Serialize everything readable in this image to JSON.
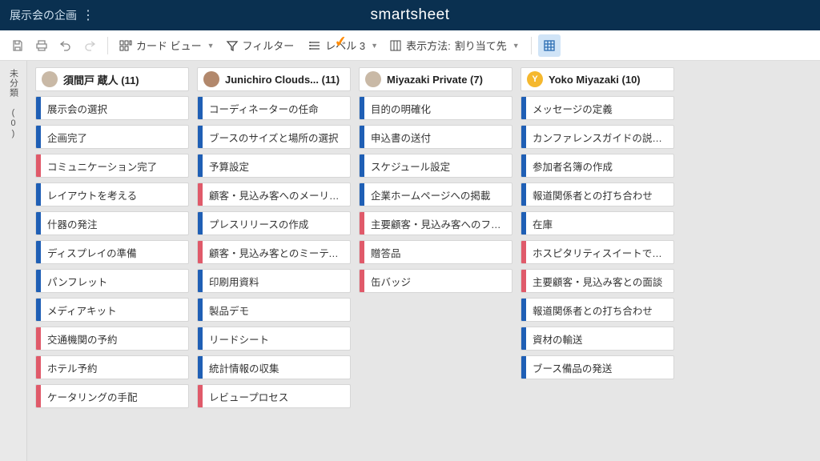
{
  "header": {
    "title": "展示会の企画",
    "brand": "smartsheet"
  },
  "toolbar": {
    "card_view": "カード ビュー",
    "filter": "フィルター",
    "level": "レベル 3",
    "display_method_label": "表示方法:",
    "display_method_value": "割り当て先"
  },
  "side": {
    "label": "未分類 (0)"
  },
  "colors": {
    "blue": "#1f5fb5",
    "red": "#e05a6a"
  },
  "columns": [
    {
      "title": "須間戸 蔵人 (11)",
      "avatar_color": "#c9b9a6",
      "avatar_text": "",
      "cards": [
        {
          "color": "blue",
          "text": "展示会の選択"
        },
        {
          "color": "blue",
          "text": "企画完了"
        },
        {
          "color": "red",
          "text": "コミュニケーション完了"
        },
        {
          "color": "blue",
          "text": "レイアウトを考える"
        },
        {
          "color": "blue",
          "text": "什器の発注"
        },
        {
          "color": "blue",
          "text": "ディスプレイの準備"
        },
        {
          "color": "blue",
          "text": "パンフレット"
        },
        {
          "color": "blue",
          "text": "メディアキット"
        },
        {
          "color": "red",
          "text": "交通機関の予約"
        },
        {
          "color": "red",
          "text": "ホテル予約"
        },
        {
          "color": "red",
          "text": "ケータリングの手配"
        }
      ]
    },
    {
      "title": "Junichiro Clouds... (11)",
      "avatar_color": "#b2886c",
      "avatar_text": "",
      "cards": [
        {
          "color": "blue",
          "text": "コーディネーターの任命"
        },
        {
          "color": "blue",
          "text": "ブースのサイズと場所の選択"
        },
        {
          "color": "blue",
          "text": "予算設定"
        },
        {
          "color": "red",
          "text": "顧客・見込み客へのメーリン..."
        },
        {
          "color": "blue",
          "text": "プレスリリースの作成"
        },
        {
          "color": "red",
          "text": "顧客・見込み客とのミーティ..."
        },
        {
          "color": "blue",
          "text": "印刷用資料"
        },
        {
          "color": "blue",
          "text": "製品デモ"
        },
        {
          "color": "blue",
          "text": "リードシート"
        },
        {
          "color": "blue",
          "text": "統計情報の収集"
        },
        {
          "color": "red",
          "text": "レビュープロセス"
        }
      ]
    },
    {
      "title": "Miyazaki Private (7)",
      "avatar_color": "#c9b9a6",
      "avatar_text": "",
      "cards": [
        {
          "color": "blue",
          "text": "目的の明確化"
        },
        {
          "color": "blue",
          "text": "申込書の送付"
        },
        {
          "color": "blue",
          "text": "スケジュール設定"
        },
        {
          "color": "blue",
          "text": "企業ホームページへの掲載"
        },
        {
          "color": "red",
          "text": "主要顧客・見込み客へのフリ..."
        },
        {
          "color": "red",
          "text": "贈答品"
        },
        {
          "color": "red",
          "text": "缶バッジ"
        }
      ]
    },
    {
      "title": "Yoko Miyazaki (10)",
      "avatar_color": "#f5b82e",
      "avatar_text": "Y",
      "cards": [
        {
          "color": "blue",
          "text": "メッセージの定義"
        },
        {
          "color": "blue",
          "text": "カンファレンスガイドの説明..."
        },
        {
          "color": "blue",
          "text": "参加者名簿の作成"
        },
        {
          "color": "blue",
          "text": "報道関係者との打ち合わせ"
        },
        {
          "color": "blue",
          "text": "在庫"
        },
        {
          "color": "red",
          "text": "ホスピタリティスイートでの..."
        },
        {
          "color": "red",
          "text": "主要顧客・見込み客との面談"
        },
        {
          "color": "blue",
          "text": "報道関係者との打ち合わせ"
        },
        {
          "color": "blue",
          "text": "資材の輸送"
        },
        {
          "color": "blue",
          "text": "ブース備品の発送"
        }
      ]
    }
  ]
}
